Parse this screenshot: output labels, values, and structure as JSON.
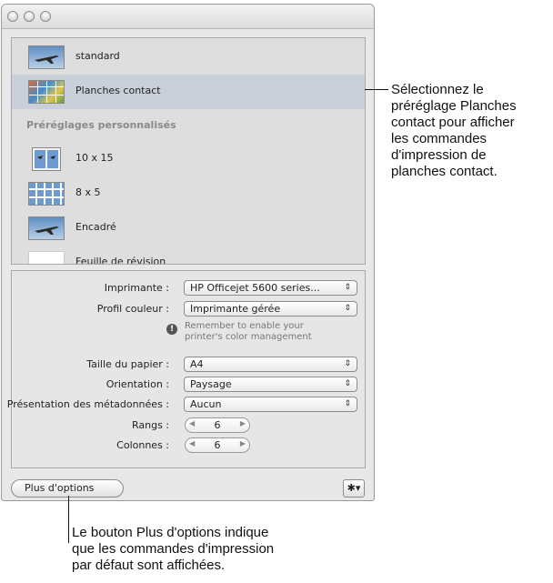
{
  "window": {
    "title": ""
  },
  "presets": {
    "items": [
      {
        "label": "standard",
        "thumb": "plane-photo-thumbnail",
        "selected": false
      },
      {
        "label": "Planches contact",
        "thumb": "contact-sheet-thumbnail",
        "selected": true
      }
    ],
    "custom_header": "Préréglages personnalisés",
    "custom_items": [
      {
        "label": "10 x 15",
        "thumb": "two-up-thumbnail"
      },
      {
        "label": "8 x 5",
        "thumb": "grid-thumbnail"
      },
      {
        "label": "Encadré",
        "thumb": "plane-photo-thumbnail"
      },
      {
        "label": "Feuille de révision",
        "thumb": "blank-thumbnail"
      }
    ]
  },
  "settings": {
    "printer_label": "Imprimante :",
    "printer_value": "HP Officejet 5600 series...",
    "profile_label": "Profil couleur :",
    "profile_value": "Imprimante gérée",
    "note_line1": "Remember to enable your",
    "note_line2": "printer's color management",
    "paper_label": "Taille du papier :",
    "paper_value": "A4",
    "orientation_label": "Orientation :",
    "orientation_value": "Paysage",
    "metadata_label": "Présentation des métadonnées :",
    "metadata_value": "Aucun",
    "rows_label": "Rangs :",
    "rows_value": "6",
    "cols_label": "Colonnes :",
    "cols_value": "6"
  },
  "footer": {
    "more_options": "Plus d'options",
    "gear": "✱▾"
  },
  "annotations": {
    "right_callout": [
      "Sélectionnez le",
      "préréglage Planches",
      "contact pour afficher",
      "les commandes",
      "d'impression de",
      "planches contact."
    ],
    "bottom_callout": [
      "Le bouton Plus d'options indique",
      "que les commandes d'impression",
      "par défaut sont affichées."
    ]
  },
  "colors": {
    "selected_row": "#c9d0da",
    "window_bg": "#e8e8e8"
  }
}
